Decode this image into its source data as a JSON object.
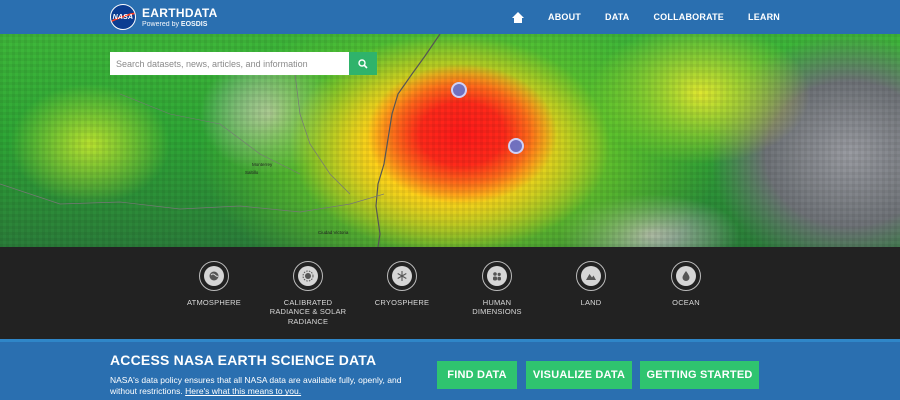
{
  "header": {
    "logo_title": "EARTHDATA",
    "logo_sub_prefix": "Powered by",
    "logo_sub_brand": "EOSDIS",
    "logo_badge": "NASA",
    "nav": [
      "ABOUT",
      "DATA",
      "COLLABORATE",
      "LEARN"
    ]
  },
  "search": {
    "placeholder": "Search datasets, news, articles, and information"
  },
  "map_labels": {
    "city_a": "Monterrey",
    "city_b": "Saltillo",
    "city_c": "Ciudad Victoria"
  },
  "categories": [
    {
      "label": "ATMOSPHERE",
      "icon": "atmosphere-icon"
    },
    {
      "label": "CALIBRATED RADIANCE & SOLAR RADIANCE",
      "icon": "radiance-icon"
    },
    {
      "label": "CRYOSPHERE",
      "icon": "snowflake-icon"
    },
    {
      "label": "HUMAN DIMENSIONS",
      "icon": "people-icon"
    },
    {
      "label": "LAND",
      "icon": "mountain-icon"
    },
    {
      "label": "OCEAN",
      "icon": "water-drop-icon"
    }
  ],
  "cta": {
    "title": "ACCESS NASA EARTH SCIENCE DATA",
    "desc": "NASA's data policy ensures that all NASA data are available fully, openly, and without restrictions.",
    "link": "Here's what this means to you.",
    "buttons": [
      "FIND DATA",
      "VISUALIZE DATA",
      "GETTING STARTED"
    ]
  },
  "colors": {
    "header_blue": "#2a6fb0",
    "button_green": "#2fc46f",
    "dark_band": "#222222"
  }
}
